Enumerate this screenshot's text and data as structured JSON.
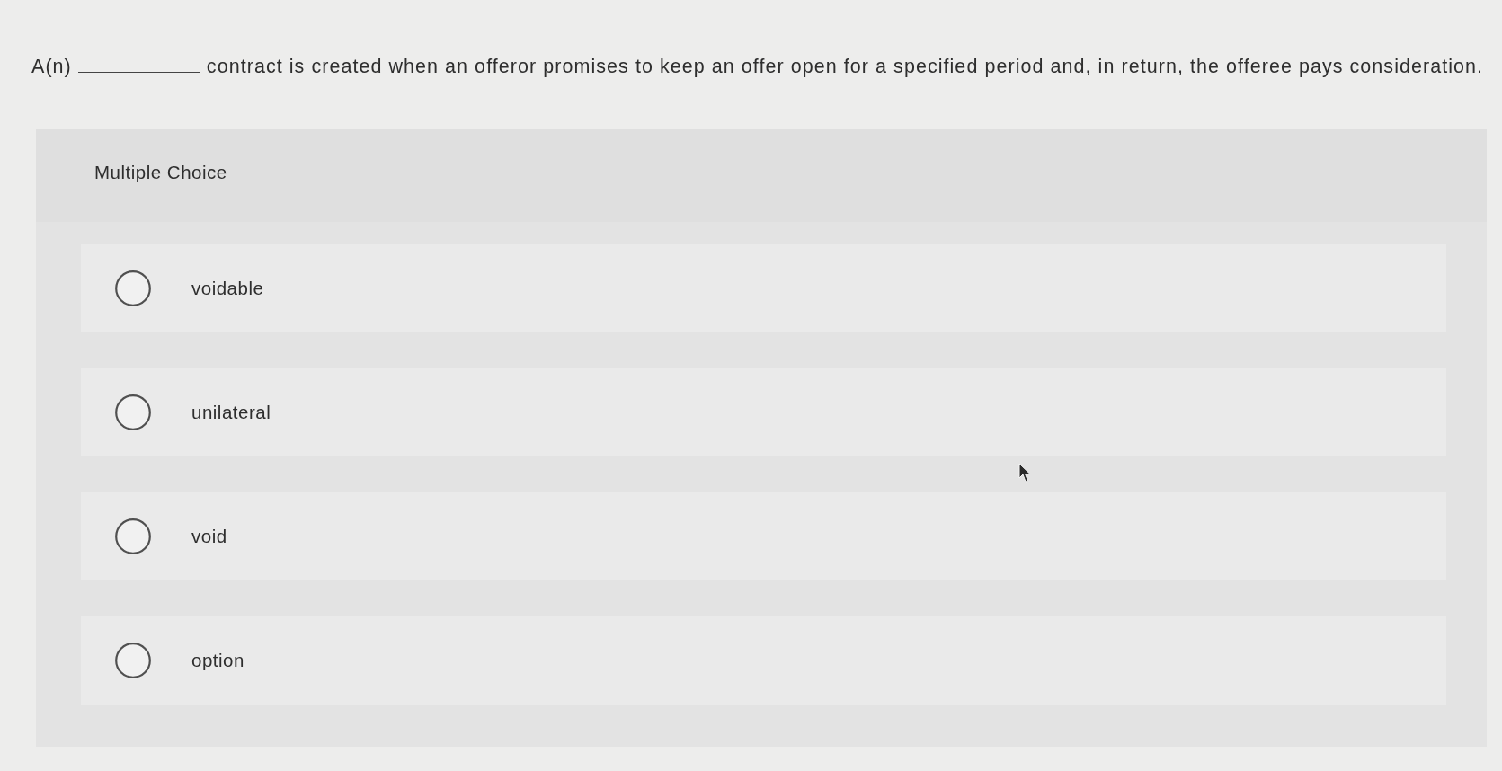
{
  "question": {
    "prefix": "A(n)",
    "text": "contract is created when an offeror promises to keep an offer open for a specified period and, in return, the offeree pays consideration."
  },
  "panel": {
    "title": "Multiple Choice"
  },
  "options": [
    {
      "label": "voidable",
      "selected": false
    },
    {
      "label": "unilateral",
      "selected": false
    },
    {
      "label": "void",
      "selected": false
    },
    {
      "label": "option",
      "selected": false
    }
  ]
}
